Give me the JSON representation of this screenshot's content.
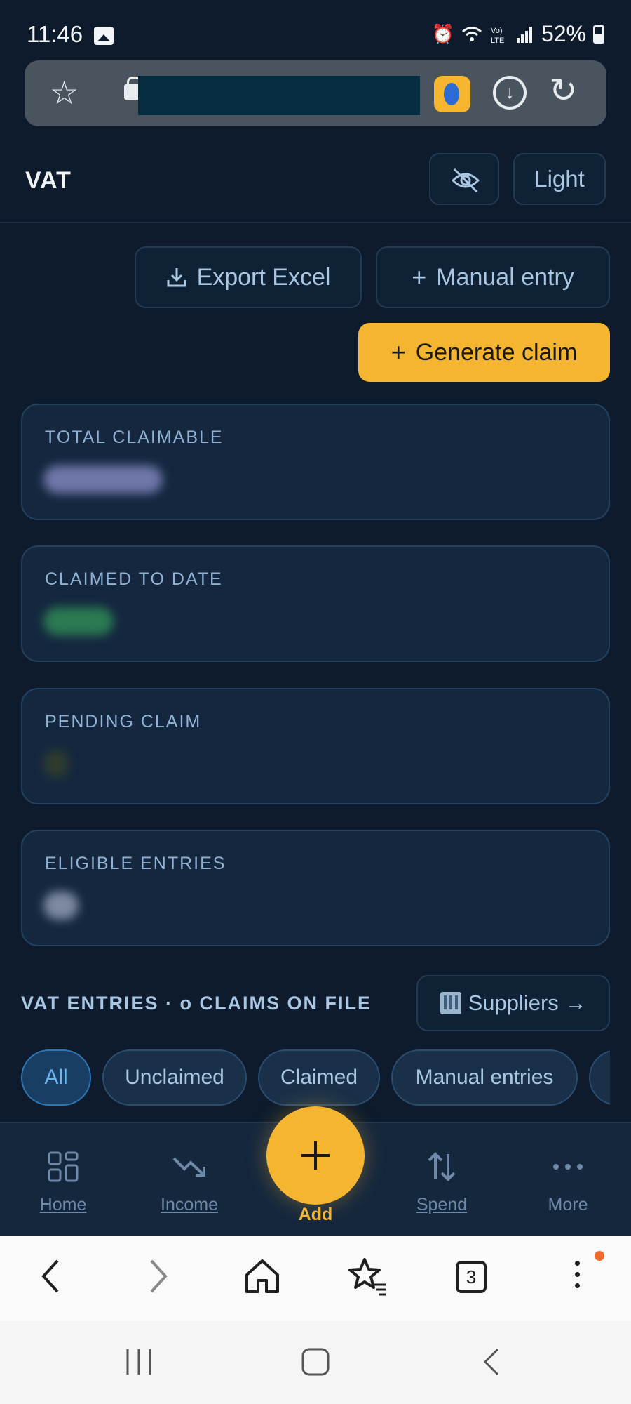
{
  "status_bar": {
    "time": "11:46",
    "battery": "52%",
    "icons": [
      "gallery-icon",
      "alarm-icon",
      "wifi-icon",
      "volte-icon",
      "signal-icon",
      "battery-icon"
    ]
  },
  "browser": {
    "tab_count": "3"
  },
  "header": {
    "title": "VAT",
    "theme_label": "Light"
  },
  "actions": {
    "export_label": "Export Excel",
    "manual_label": "Manual entry",
    "generate_label": "Generate claim"
  },
  "stats": [
    {
      "label": "TOTAL CLAIMABLE",
      "value_color": "#7f86b8"
    },
    {
      "label": "CLAIMED TO DATE",
      "value_color": "#2f8a5a"
    },
    {
      "label": "PENDING CLAIM",
      "value_color": "#2a3a30"
    },
    {
      "label": "ELIGIBLE ENTRIES",
      "value_color": "#8a97b0"
    }
  ],
  "section": {
    "title": "VAT ENTRIES · o CLAIMS ON FILE",
    "suppliers_label": "Suppliers →"
  },
  "filters": [
    "All",
    "Unclaimed",
    "Claimed",
    "Manual entries",
    ""
  ],
  "nav": {
    "home": "Home",
    "income": "Income",
    "add": "Add",
    "spend": "Spend",
    "more": "More"
  },
  "colors": {
    "background": "#0d1b2c",
    "card": "#14273f",
    "accent": "#f4b531",
    "active_chip": "#6cb5ef"
  }
}
